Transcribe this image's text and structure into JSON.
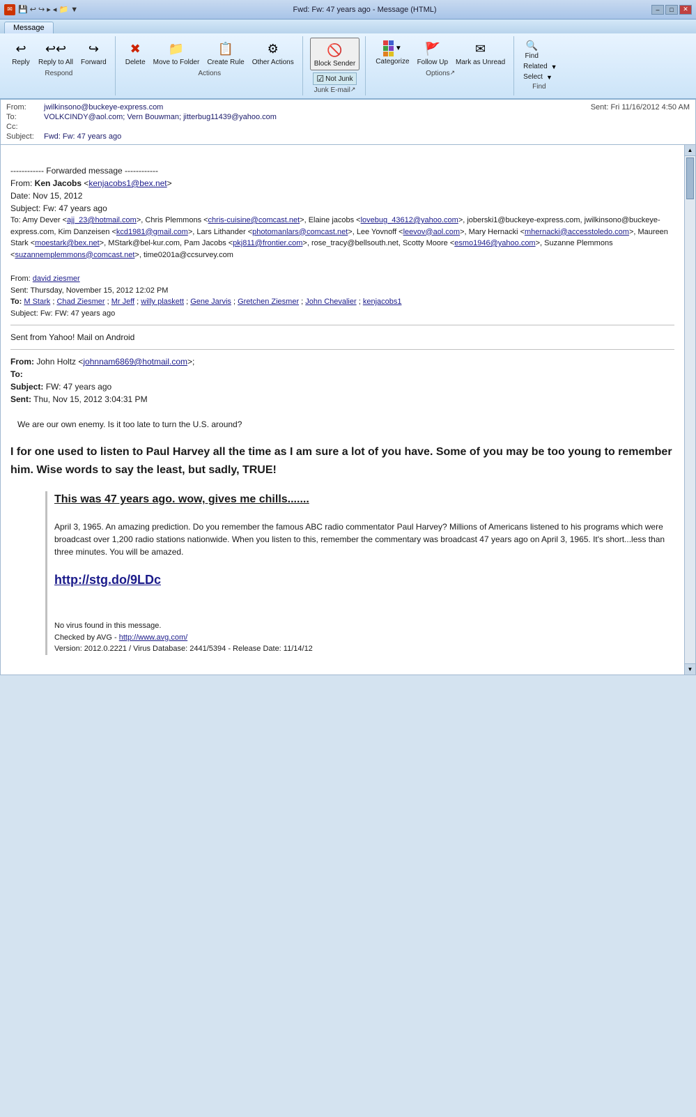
{
  "titlebar": {
    "title": "Fwd: Fw: 47 years ago - Message (HTML)",
    "min": "–",
    "max": "□",
    "close": "✕"
  },
  "tab": "Message",
  "ribbon": {
    "respond": {
      "label": "Respond",
      "reply_label": "Reply",
      "reply_all_label": "Reply\nto All",
      "forward_label": "Forward"
    },
    "actions": {
      "label": "Actions",
      "delete_label": "Delete",
      "move_label": "Move to\nFolder",
      "create_label": "Create\nRule",
      "other_label": "Other\nActions"
    },
    "junk": {
      "label": "Junk E-mail",
      "block_label": "Block\nSender",
      "not_junk_label": "Not Junk"
    },
    "options": {
      "label": "Options",
      "categorize_label": "Categorize",
      "follow_up_label": "Follow\nUp",
      "mark_unread_label": "Mark as\nUnread"
    },
    "find": {
      "label": "Find",
      "find_label": "Find",
      "related_label": "Related",
      "select_label": "Select"
    }
  },
  "email": {
    "from_label": "From:",
    "from_value": "jwilkinsono@buckeye-express.com",
    "to_label": "To:",
    "to_value": "VOLKCINDY@aol.com; Vern Bouwman; jitterbug11439@yahoo.com",
    "cc_label": "Cc:",
    "subject_label": "Subject:",
    "subject_value": "Fwd: Fw: 47 years ago",
    "sent_label": "Sent:",
    "sent_value": "Fri 11/16/2012 4:50 AM"
  },
  "body": {
    "forwarded_header": "------------ Forwarded message ------------",
    "from1": "Ken Jacobs",
    "from1_email": "kenjacobs1@bex.net",
    "date1": "Nov 15, 2012",
    "subject1": "Fw: 47 years ago",
    "to_long": "To: Amy Dever <ajj_23@hotmail.com>, Chris Plemmons <chris-cuisine@comcast.net>, Elaine jacobs <lovebug_43612@yahoo.com>, joberski1@buckeye-express.com, jwilkinsono@buckeye-express.com, Kim Danzeisen <kcd1981@gmail.com>, Lars Lithander <photomanlars@comcast.net>, Lee Yovnoff <leevov@aol.com>, Mary Hernacki <mhernacki@accesstoledo.com>, Maureen Stark <moestark@bex.net>, MStark@bel-kur.com, Pam Jacobs <pkj811@frontier.com>, rose_tracy@bellsouth.net, Scotty Moore <esmo1946@yahoo.com>, Suzanne Plemmons <suzannemplemmons@comcast.net>, time0201a@ccsurvey.com",
    "from2_label": "From:",
    "from2": "david ziesmer",
    "sent2_label": "Sent:",
    "sent2": "Thursday, November 15, 2012 12:02 PM",
    "to2_label": "To:",
    "to2_values": [
      "M Stark",
      "Chad Ziesmer",
      "Mr Jeff",
      "willy plaskett",
      "Gene Jarvis",
      "Gretchen Ziesmer",
      "John Chevalier",
      "kenjacobs1"
    ],
    "subject2_label": "Subject:",
    "subject2": "Fw: FW: 47 years ago",
    "yahoo_sent": "Sent from Yahoo! Mail on Android",
    "from3_label": "From:",
    "from3": "John Holtz",
    "from3_email": "johnnam6869@hotmail.com",
    "to3_label": "To:",
    "subject3_label": "Subject:",
    "subject3": "FW: 47 years ago",
    "sent3_label": "Sent:",
    "sent3": "Thu, Nov 15, 2012 3:04:31 PM",
    "body_intro": "We are our own enemy. Is it too late to turn the U.S. around?",
    "body_main": "I for one used to listen to Paul Harvey all the time as I am sure a lot of you have.  Some of you may be too young to remember him.  Wise words to say the least, but sadly, TRUE!",
    "chills_heading": " This was 47 years ago. wow, gives me chills.......",
    "paul_harvey_text": "April 3, 1965. An amazing prediction. Do you remember the famous ABC radio commentator Paul Harvey? Millions of Americans listened to his programs which were broadcast over 1,200 radio stations nationwide. When you listen to this, remember the commentary was broadcast 47 years ago on April 3, 1965.  It's short...less than three minutes. You will be amazed.",
    "link": "http://stg.do/9LDc",
    "virus_line1": "No virus found in this message.",
    "virus_line2": "Checked by AVG - http://www.avg.com/",
    "virus_line3": "Version: 2012.0.2221 / Virus Database: 2441/5394 - Release Date: 11/14/12"
  }
}
